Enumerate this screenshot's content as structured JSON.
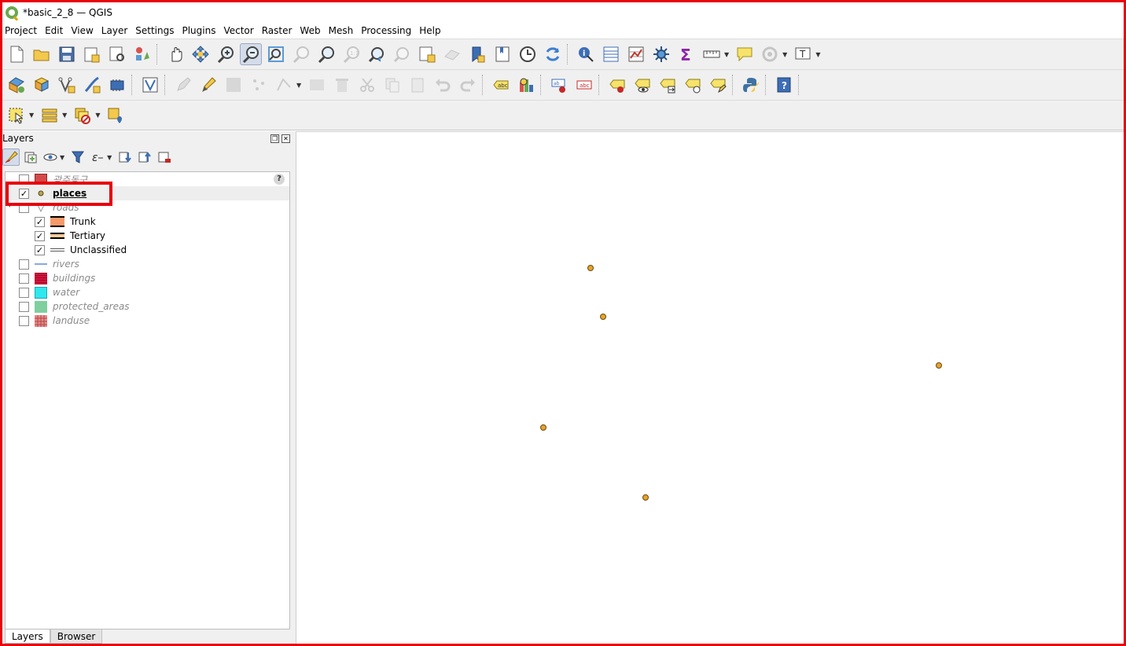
{
  "window": {
    "title": "*basic_2_8 — QGIS"
  },
  "menubar": {
    "items": [
      "Project",
      "Edit",
      "View",
      "Layer",
      "Settings",
      "Plugins",
      "Vector",
      "Raster",
      "Web",
      "Mesh",
      "Processing",
      "Help"
    ]
  },
  "layers_panel": {
    "title": "Layers",
    "layers": {
      "gwangju": {
        "label": "광주동구",
        "visible": false
      },
      "places": {
        "label": "places",
        "visible": true
      },
      "roads": {
        "label": "roads",
        "visible": false
      },
      "trunk": {
        "label": "Trunk",
        "visible": true
      },
      "tertiary": {
        "label": "Tertiary",
        "visible": true
      },
      "unclassified": {
        "label": "Unclassified",
        "visible": true
      },
      "rivers": {
        "label": "rivers",
        "visible": false
      },
      "buildings": {
        "label": "buildings",
        "visible": false
      },
      "water": {
        "label": "water",
        "visible": false
      },
      "protected_areas": {
        "label": "protected_areas",
        "visible": false
      },
      "landuse": {
        "label": "landuse",
        "visible": false
      }
    },
    "help_badge": "?",
    "tabs": {
      "layers": "Layers",
      "browser": "Browser"
    }
  },
  "checkmark": "✓",
  "colors": {
    "accent_red": "#e8000b",
    "point_fill": "#e5a22c",
    "water": "#2ee8ee",
    "protected": "#7fcf9f",
    "buildings": "#d4143c",
    "gwangju": "#d44a4a"
  }
}
